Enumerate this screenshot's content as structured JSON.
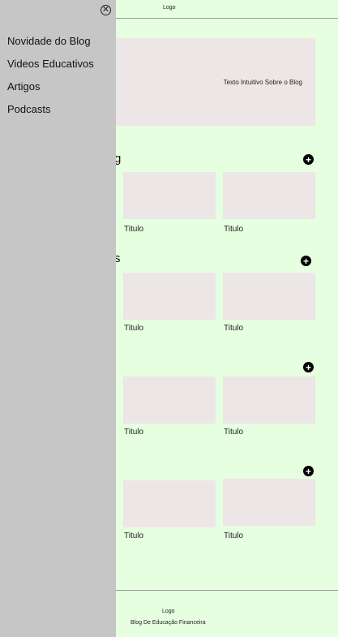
{
  "header": {
    "logo": "Logo"
  },
  "hero": {
    "text": "Texto Intuitivo Sobre o Blog"
  },
  "sections": [
    {
      "title_visible": "g",
      "cards": [
        "Titulo",
        "Titulo"
      ]
    },
    {
      "title_visible": "s",
      "cards": [
        "Titulo",
        "Titulo"
      ]
    },
    {
      "title_visible": "",
      "cards": [
        "Titulo",
        "Titulo"
      ]
    },
    {
      "title_visible": "",
      "cards": [
        "Titulo",
        "Titulo"
      ]
    }
  ],
  "footer": {
    "logo": "Logo",
    "tagline": "Blog De Educação Financeira"
  },
  "drawer": {
    "close_icon": "⊗",
    "items": [
      "Novidade do Blog",
      "Videos Educativos",
      "Artigos",
      "Podcasts"
    ]
  },
  "icons": {
    "add": "+",
    "close": "close-icon"
  },
  "colors": {
    "background": "#e6ffe0",
    "drawer": "#c6c6c6",
    "card": "#ede6e6"
  }
}
